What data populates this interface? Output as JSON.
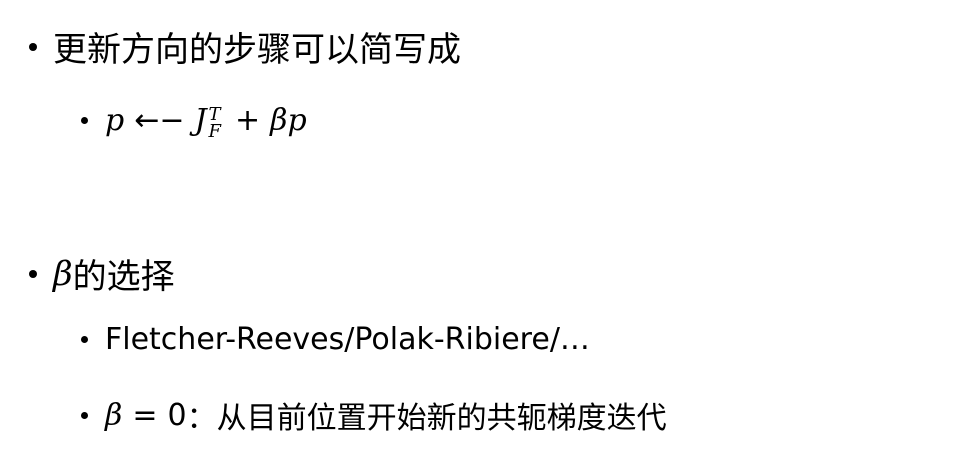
{
  "bullets": {
    "b1": {
      "text": "更新方向的步骤可以简写成"
    },
    "b1_1": {
      "p1": "p",
      "arrow": "←−",
      "J": "J",
      "sup": "T",
      "sub": "F",
      "plus": "+",
      "beta": "β",
      "p2": "p"
    },
    "b2": {
      "beta": "β",
      "text": "的选择"
    },
    "b2_1": {
      "text": "Fletcher-Reeves/Polak-Ribiere/…"
    },
    "b2_2": {
      "beta": "β",
      "eq": "=",
      "zero": "0",
      "colon": "：",
      "text": "从目前位置开始新的共轭梯度迭代"
    }
  }
}
